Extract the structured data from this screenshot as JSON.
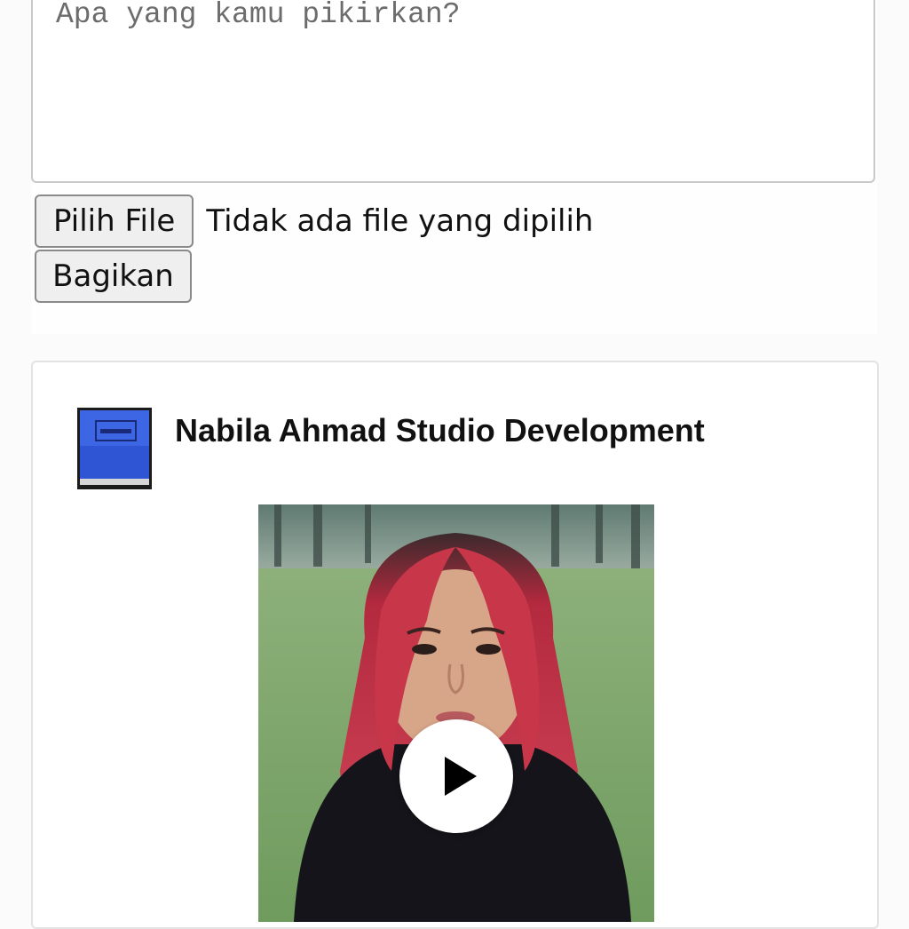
{
  "composer": {
    "textarea_placeholder": "Apa yang kamu pikirkan?",
    "file_button_label": "Pilih File",
    "file_status": "Tidak ada file yang dipilih",
    "share_button_label": "Bagikan"
  },
  "post": {
    "author_name": "Nabila Ahmad Studio Development",
    "avatar_icon": "blue-book-icon",
    "media_type": "video",
    "play_icon": "play-icon"
  },
  "colors": {
    "avatar_blue": "#2f55d4",
    "hair_red": "#d0344a"
  }
}
